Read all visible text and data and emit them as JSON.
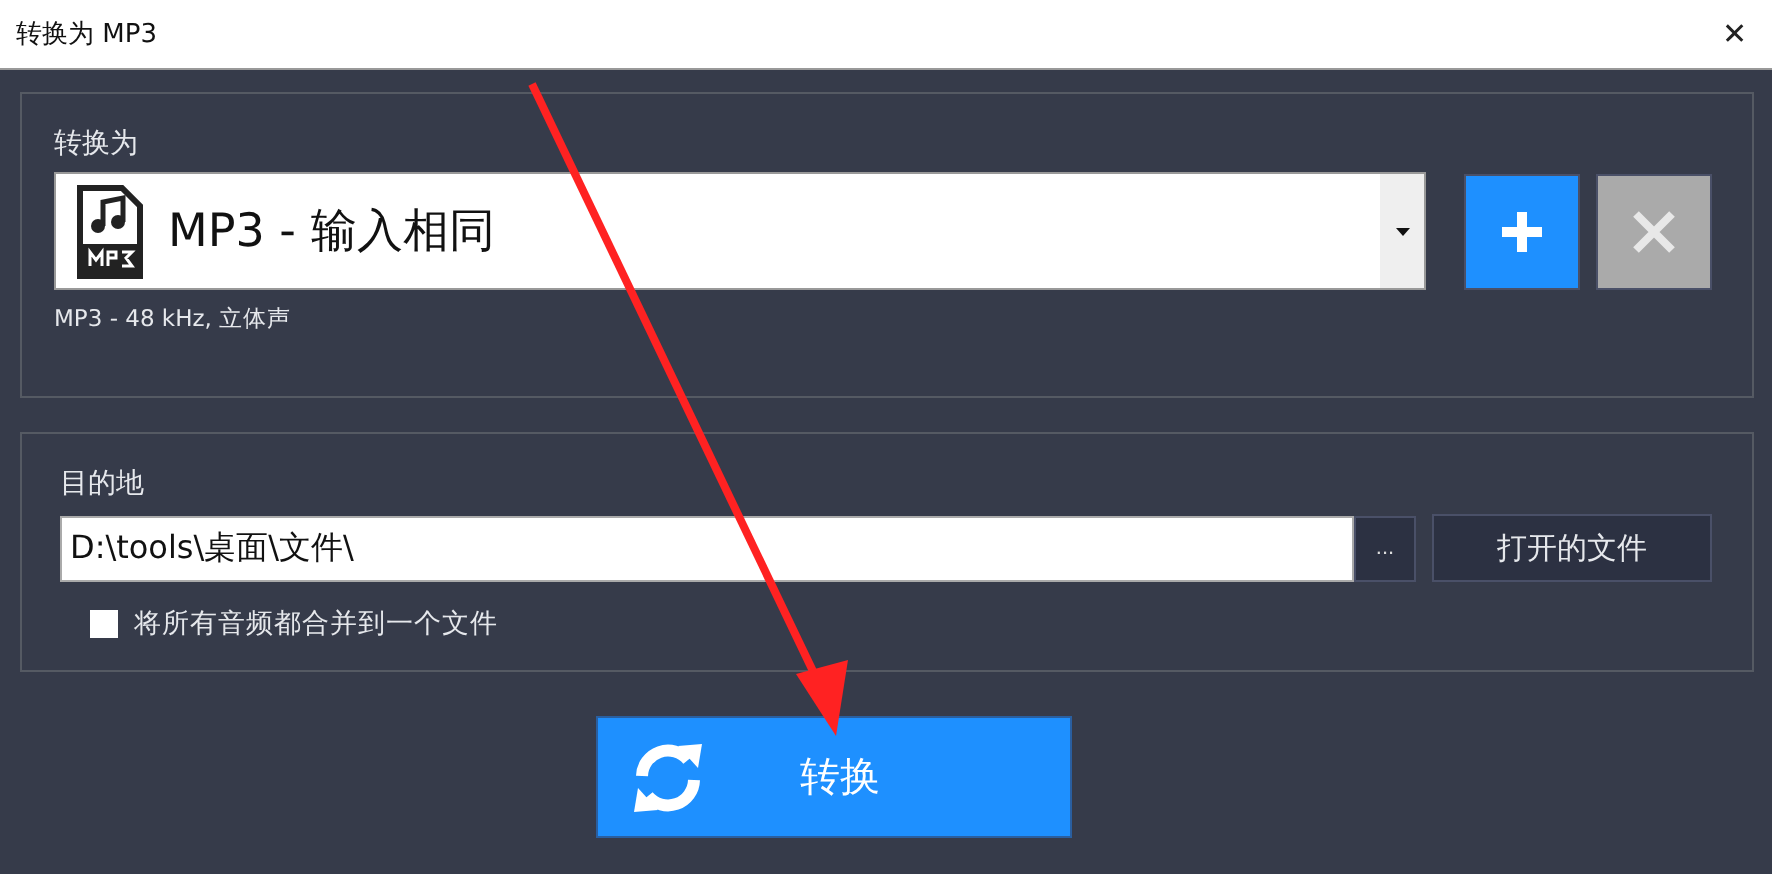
{
  "window": {
    "title": "转换为 MP3",
    "close": "✕"
  },
  "format": {
    "label": "转换为",
    "selected_format": "MP3 - 输入相同",
    "details": "MP3  -  48 kHz,  立体声",
    "add_button": {
      "disabled": false
    },
    "remove_button": {
      "disabled": true
    }
  },
  "destination": {
    "label": "目的地",
    "path": "D:\\tools\\桌面\\文件\\",
    "browse": "...",
    "open_button": "打开的文件",
    "merge_checkbox": {
      "label": "将所有音频都合并到一个文件",
      "checked": false
    }
  },
  "convert_button": "转换"
}
